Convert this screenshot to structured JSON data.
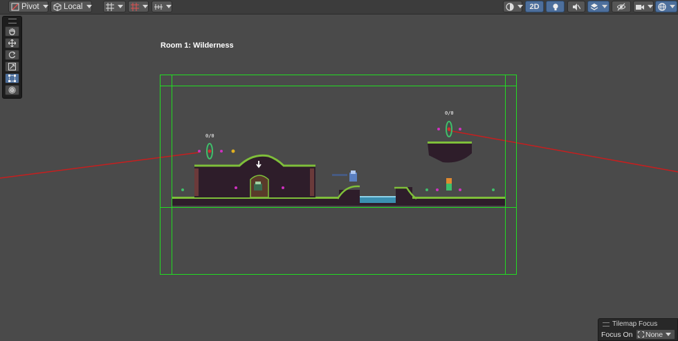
{
  "toolbar": {
    "pivot_label": "Pivot",
    "local_label": "Local",
    "view_2d_label": "2D"
  },
  "tools": {
    "items": [
      "hand-tool",
      "move-tool",
      "rotate-tool",
      "scale-tool",
      "rect-tool",
      "transform-tool"
    ],
    "selected": "rect-tool"
  },
  "scene": {
    "room_title": "Room 1: Wilderness",
    "counter_left": "0/0",
    "counter_right": "0/0"
  },
  "overlay": {
    "title": "Tilemap Focus",
    "focus_label": "Focus On",
    "focus_value": "None"
  },
  "colors": {
    "room_bounds": "#22dd22",
    "camera_line": "#c81e1e",
    "grass": "#7fbf3a",
    "terrain": "#2e1d2a",
    "water": "#3b8fb0",
    "background": "#4a4a4a",
    "selected_tool": "#4d6f9c"
  }
}
